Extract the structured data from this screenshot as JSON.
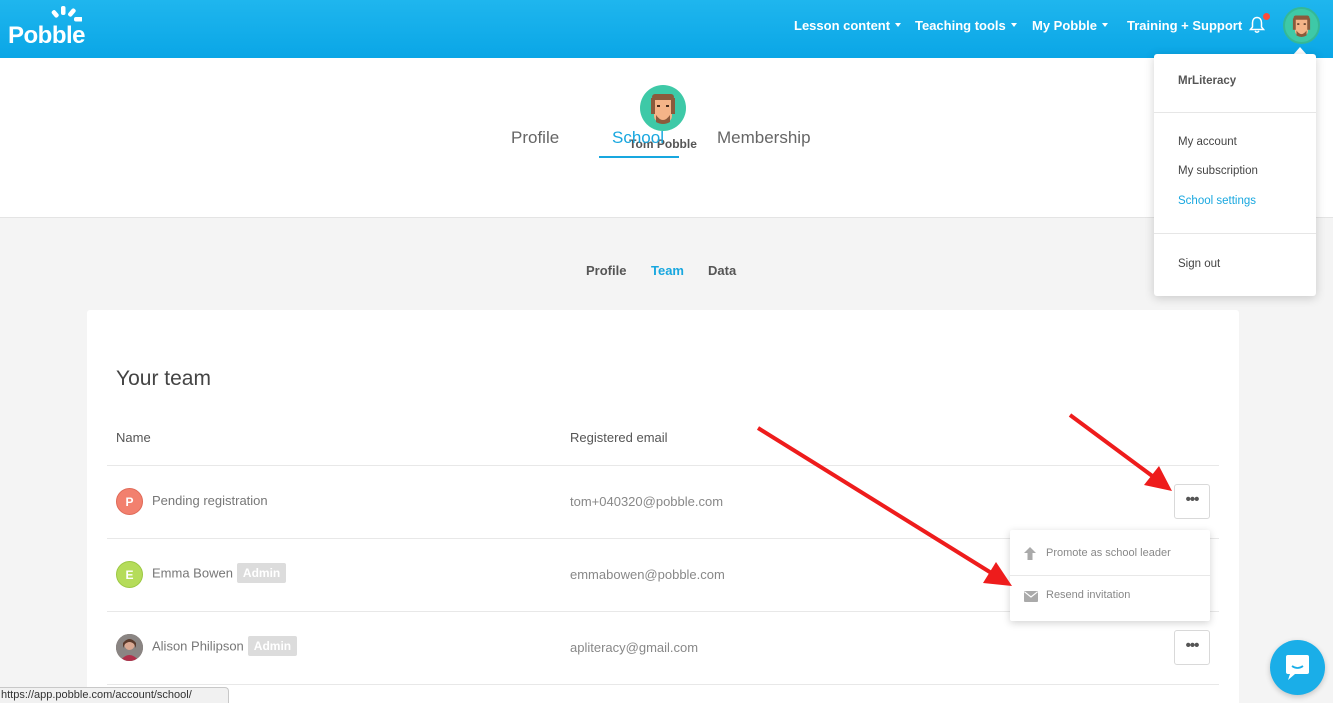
{
  "brand": {
    "name": "Pobble",
    "accent": "#18a7df",
    "header_color": "#0aa6e6"
  },
  "nav": {
    "items": [
      {
        "label": "Lesson content",
        "dropdown": true
      },
      {
        "label": "Teaching tools",
        "dropdown": true
      },
      {
        "label": "My Pobble",
        "dropdown": true
      },
      {
        "label": "Training + Support",
        "dropdown": false
      }
    ],
    "notifications_icon": "bell-icon",
    "has_unread": true
  },
  "account_menu": {
    "username": "MrLiteracy",
    "items": [
      {
        "label": "My account",
        "active": false
      },
      {
        "label": "My subscription",
        "active": false
      },
      {
        "label": "School settings",
        "active": true
      }
    ],
    "sign_out": "Sign out"
  },
  "profile": {
    "name": "Tom Pobble",
    "tabs": [
      {
        "label": "Profile",
        "active": false
      },
      {
        "label": "School",
        "active": true
      },
      {
        "label": "Membership",
        "active": false
      }
    ]
  },
  "school": {
    "sub_tabs": [
      {
        "label": "Profile",
        "active": false
      },
      {
        "label": "Team",
        "active": true
      },
      {
        "label": "Data",
        "active": false
      }
    ]
  },
  "team": {
    "title": "Your team",
    "columns": {
      "name": "Name",
      "email": "Registered email"
    },
    "members": [
      {
        "initial": "P",
        "name": "Pending registration",
        "badge": "",
        "email": "tom+040320@pobble.com",
        "avatar_color": "#f2806e"
      },
      {
        "initial": "E",
        "name": "Emma Bowen",
        "badge": "Admin",
        "email": "emmabowen@pobble.com",
        "avatar_color": "#b5dc5a"
      },
      {
        "initial": "",
        "name": "Alison Philipson",
        "badge": "Admin",
        "email": "apliteracy@gmail.com",
        "avatar_color": "#6b5a55"
      }
    ],
    "more_icon": "ellipsis-icon",
    "row_menu": {
      "items": [
        {
          "label": "Promote as school leader",
          "icon": "arrow-up-icon"
        },
        {
          "label": "Resend invitation",
          "icon": "envelope-icon"
        }
      ]
    }
  },
  "status_bar": {
    "url": "https://app.pobble.com/account/school/"
  },
  "annotation_color": "#ee1c1c"
}
